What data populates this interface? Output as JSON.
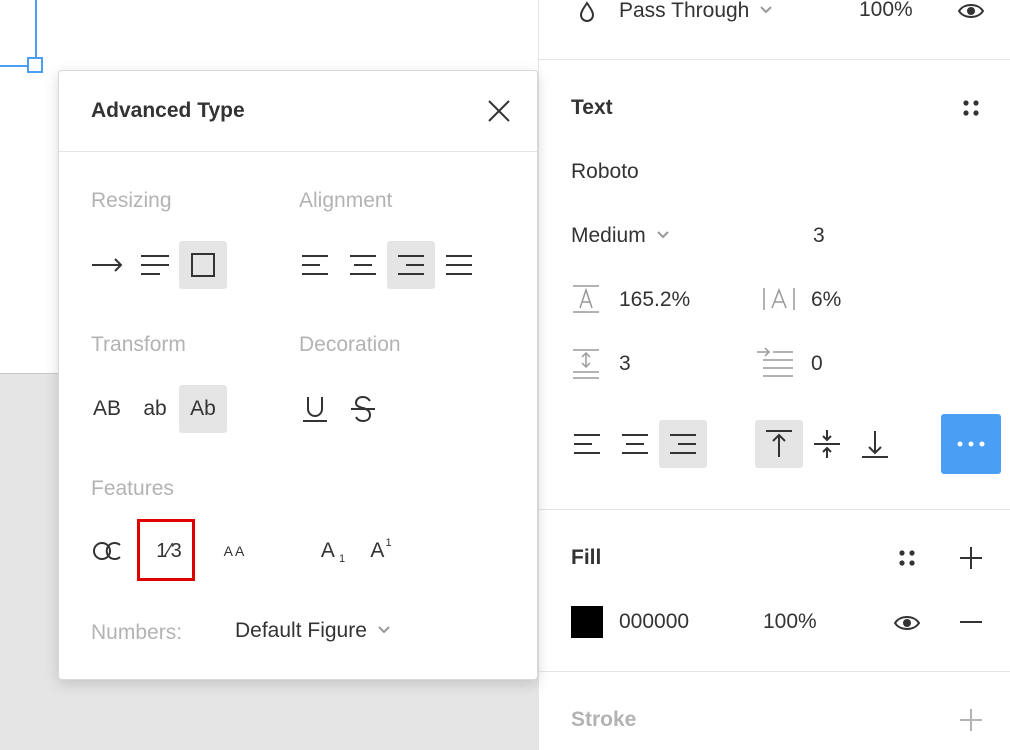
{
  "canvas": {
    "selection_color": "#4a9ff5"
  },
  "layer": {
    "blend_mode": "Pass Through",
    "opacity": "100%",
    "blend_icon": "drop-icon",
    "visibility_icon": "eye-icon"
  },
  "text_section": {
    "title": "Text",
    "font_family": "Roboto",
    "font_weight": "Medium",
    "font_size": "3",
    "line_height": "165.2%",
    "letter_spacing": "6%",
    "paragraph_spacing": "3",
    "paragraph_indent": "0"
  },
  "fill_section": {
    "title": "Fill",
    "color_hex": "000000",
    "swatch_color": "#000000",
    "opacity": "100%"
  },
  "stroke_section": {
    "title": "Stroke"
  },
  "popup": {
    "title": "Advanced Type",
    "resizing_label": "Resizing",
    "alignment_label": "Alignment",
    "transform_label": "Transform",
    "decoration_label": "Decoration",
    "features_label": "Features",
    "transform_upper": "AB",
    "transform_lower": "ab",
    "transform_title": "Ab",
    "fraction_glyph": "1⁄3",
    "small_caps_glyph": "AA",
    "subscript_glyph": "A",
    "subscript_mark": "1",
    "superscript_glyph": "A",
    "superscript_mark": "1",
    "numbers_label": "Numbers:",
    "numbers_value": "Default Figure",
    "highlight_color": "#e00000"
  },
  "colors": {
    "accent": "#4a9ff5",
    "muted_text": "#b3b3b3",
    "selected_bg": "#e5e5e5"
  }
}
